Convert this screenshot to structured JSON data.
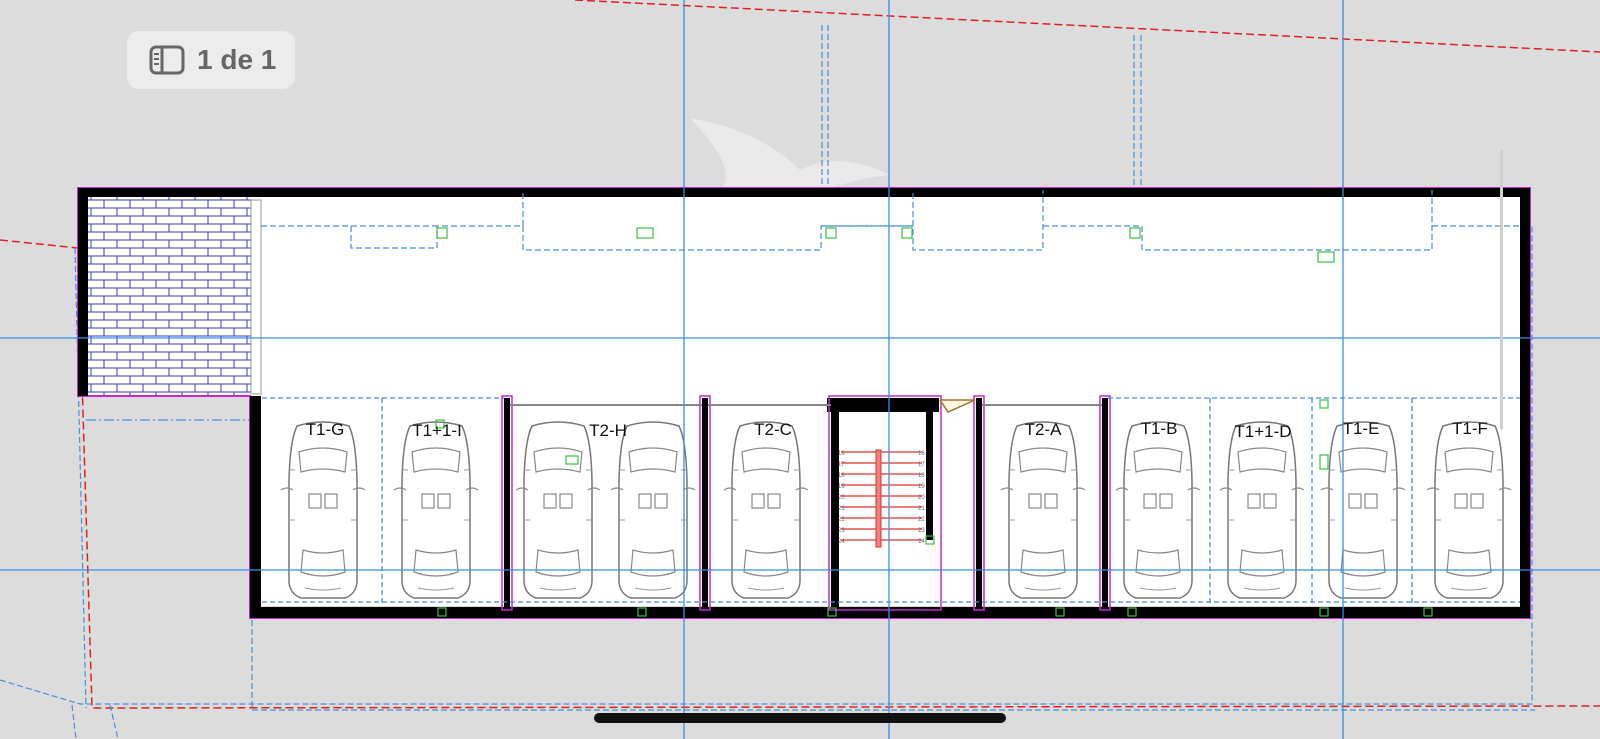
{
  "viewer": {
    "page_indicator": "1 de 1",
    "sidebar_icon": "sidebar-icon"
  },
  "plan": {
    "parking_labels": [
      "T1-G",
      "T1+1-I",
      "T2-H",
      "T2-C",
      "T2-A",
      "T1-B",
      "T1+1-D",
      "T1-E",
      "T1-F"
    ],
    "stair_numbers": [
      "16",
      "17",
      "18",
      "19",
      "20",
      "21",
      "22",
      "23",
      "24"
    ]
  },
  "colors": {
    "background": "#dcdcdc",
    "wall": "#000000",
    "outline_magenta": "#c02ad0",
    "grid_blue": "#3a8ee8",
    "dashed_blue": "#4a8fd8",
    "property_red": "#e02020",
    "stair_red": "#e03030",
    "brick_blue": "#3a3ab8"
  }
}
